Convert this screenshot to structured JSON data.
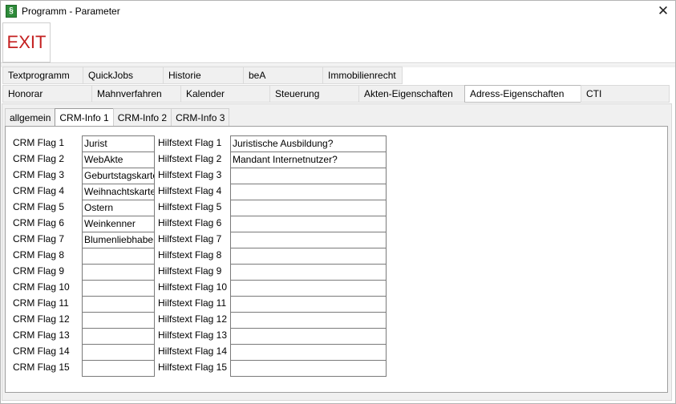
{
  "window": {
    "title": "Programm - Parameter",
    "app_icon": "§",
    "close_icon": "✕"
  },
  "toolbar": {
    "exit_label": "EXIT"
  },
  "tabs_row1": [
    "Textprogramm",
    "QuickJobs",
    "Historie",
    "beA",
    "Immobilienrecht"
  ],
  "tabs_row2": [
    "Honorar",
    "Mahnverfahren",
    "Kalender",
    "Steuerung",
    "Akten-Eigenschaften",
    "Adress-Eigenschaften",
    "CTI"
  ],
  "subtabs": [
    "allgemein",
    "CRM-Info 1",
    "CRM-Info 2",
    "CRM-Info 3"
  ],
  "rows": [
    {
      "flag_label": "CRM Flag 1",
      "flag_value": "Jurist",
      "help_label": "Hilfstext Flag 1",
      "help_value": "Juristische Ausbildung?"
    },
    {
      "flag_label": "CRM Flag 2",
      "flag_value": "WebAkte",
      "help_label": "Hilfstext Flag 2",
      "help_value": "Mandant Internetnutzer?"
    },
    {
      "flag_label": "CRM Flag 3",
      "flag_value": "Geburtstagskarte",
      "help_label": "Hilfstext Flag 3",
      "help_value": ""
    },
    {
      "flag_label": "CRM Flag 4",
      "flag_value": "Weihnachtskarte",
      "help_label": "Hilfstext Flag 4",
      "help_value": ""
    },
    {
      "flag_label": "CRM Flag 5",
      "flag_value": "Ostern",
      "help_label": "Hilfstext Flag 5",
      "help_value": ""
    },
    {
      "flag_label": "CRM Flag 6",
      "flag_value": "Weinkenner",
      "help_label": "Hilfstext Flag 6",
      "help_value": ""
    },
    {
      "flag_label": "CRM Flag 7",
      "flag_value": "Blumenliebhaber",
      "help_label": "Hilfstext Flag 7",
      "help_value": ""
    },
    {
      "flag_label": "CRM Flag 8",
      "flag_value": "",
      "help_label": "Hilfstext Flag 8",
      "help_value": ""
    },
    {
      "flag_label": "CRM Flag 9",
      "flag_value": "",
      "help_label": "Hilfstext Flag 9",
      "help_value": ""
    },
    {
      "flag_label": "CRM Flag 10",
      "flag_value": "",
      "help_label": "Hilfstext Flag 10",
      "help_value": ""
    },
    {
      "flag_label": "CRM Flag 11",
      "flag_value": "",
      "help_label": "Hilfstext Flag 11",
      "help_value": ""
    },
    {
      "flag_label": "CRM Flag 12",
      "flag_value": "",
      "help_label": "Hilfstext Flag 12",
      "help_value": ""
    },
    {
      "flag_label": "CRM Flag 13",
      "flag_value": "",
      "help_label": "Hilfstext Flag 13",
      "help_value": ""
    },
    {
      "flag_label": "CRM Flag 14",
      "flag_value": "",
      "help_label": "Hilfstext Flag 14",
      "help_value": ""
    },
    {
      "flag_label": "CRM Flag 15",
      "flag_value": "",
      "help_label": "Hilfstext Flag 15",
      "help_value": ""
    }
  ]
}
